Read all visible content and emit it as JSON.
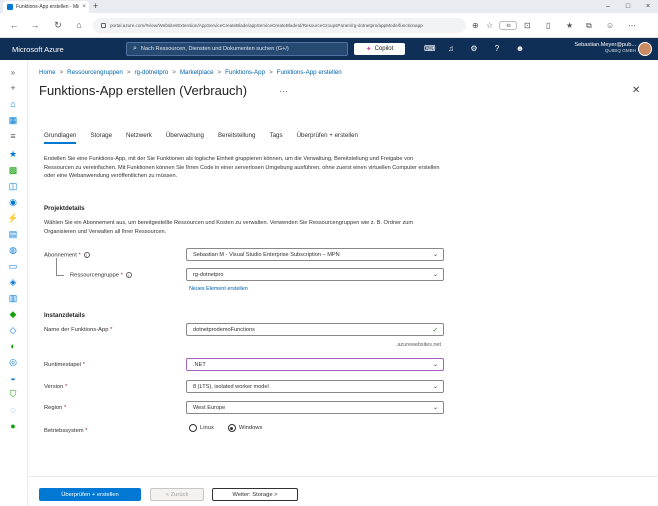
{
  "browser": {
    "tab_title": "Funktions-App erstellen - Micr...",
    "url": "portal.azure.com/#view/WebsitesExtension/AppServiceCreateBlade/appServiceCreateBladeId/ResourceGroupsParam/rg-dotnetpro/appMode/functionapp"
  },
  "azure": {
    "brand": "Microsoft Azure",
    "search_placeholder": "Nach Ressourcen, Diensten und Dokumenten suchen (G+/)",
    "copilot_label": "Copilot",
    "user_name": "Sebastian.Meyer@pub...",
    "user_tenant": "QUIBIQ GMBH"
  },
  "breadcrumb": [
    "Home",
    "Ressourcengruppen",
    "rg-dotnetpro",
    "Marketplace",
    "Funktions-App",
    "Funktions-App erstellen"
  ],
  "page": {
    "title": "Funktions-App erstellen (Verbrauch)",
    "more": "···",
    "close": "✕"
  },
  "tabs": [
    "Grundlagen",
    "Storage",
    "Netzwerk",
    "Überwachung",
    "Bereitstellung",
    "Tags",
    "Überprüfen + erstellen"
  ],
  "active_tab": "Grundlagen",
  "intro_text": "Erstellen Sie eine Funktions-App, mit der Sie Funktionen als logische Einheit gruppieren können, um die Verwaltung, Bereitstellung und Freigabe von Ressourcen zu vereinfachen. Mit Funktionen können Sie Ihren Code in einer serverlosen Umgebung ausführen, ohne zuerst einen virtuellen Computer erstellen oder eine Webanwendung veröffentlichen zu müssen.",
  "project": {
    "heading": "Projektdetails",
    "description": "Wählen Sie ein Abonnement aus, um bereitgestellte Ressourcen und Kosten zu verwalten. Verwenden Sie Ressourcengruppen wie z. B. Ordner zum Organisieren und Verwalten all Ihrer Ressourcen.",
    "subscription_label": "Abonnement",
    "subscription_value": "Sebastian M - Visual Studio Enterprise Subscription – MPN",
    "resource_group_label": "Ressourcengruppe",
    "resource_group_value": "rg-dotnetpro",
    "new_link": "Neues Element erstellen"
  },
  "instance": {
    "heading": "Instanzdetails",
    "name_label": "Name der Funktions-App",
    "name_value": "dotnetprodemoFunctions",
    "name_suffix": ".azurewebsites.net",
    "runtime_label": "Runtimestapel",
    "runtime_value": ".NET",
    "version_label": "Version",
    "version_value": "8 (LTS), isolated worker model",
    "region_label": "Region",
    "region_value": "West Europe",
    "os_label": "Betriebssystem",
    "os_options": [
      "Linux",
      "Windows"
    ],
    "os_selected": "Windows"
  },
  "footer": {
    "review_button": "Überprüfen + erstellen",
    "back_button": "< Zurück",
    "next_button": "Weiter: Storage >"
  },
  "colors": {
    "azure_bar": "#0f2f57",
    "primary": "#0078d4",
    "focus_border": "#a561c4"
  }
}
